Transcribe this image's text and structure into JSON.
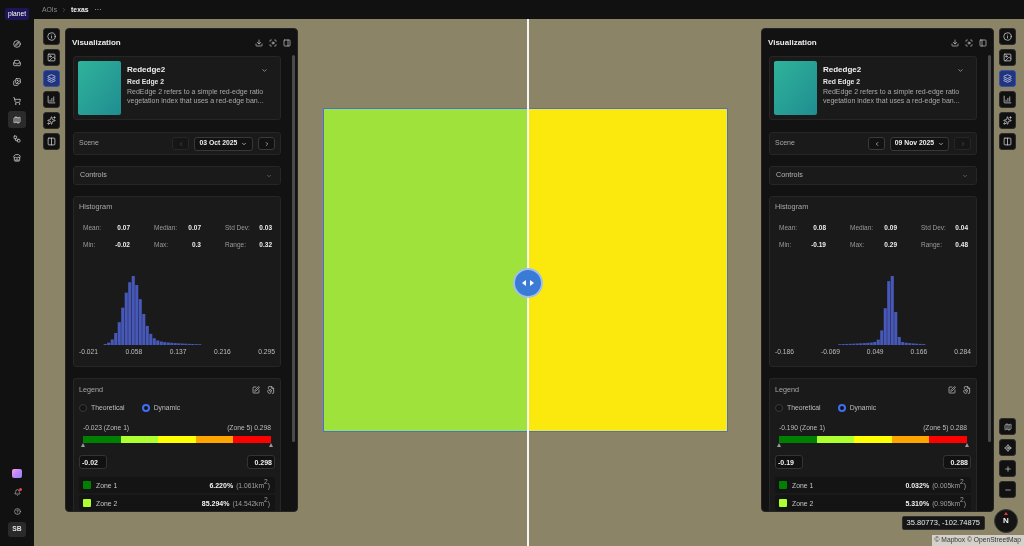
{
  "nav_rail": {
    "logo_text": "planet",
    "items": [
      {
        "selected": false
      },
      {
        "selected": false
      },
      {
        "selected": false
      },
      {
        "selected": false
      },
      {
        "selected": true
      },
      {
        "selected": false
      },
      {
        "selected": false
      }
    ],
    "has_notification": true,
    "avatar": "SB"
  },
  "breadcrumb": {
    "items": [
      "AOIs",
      "texas"
    ],
    "more": "···"
  },
  "panels": [
    {
      "tools": [
        {
          "selected": false
        },
        {
          "selected": false
        },
        {
          "selected": true
        },
        {
          "selected": false
        },
        {
          "selected": false
        },
        {
          "selected": false
        }
      ],
      "title": "Visualization",
      "layer": {
        "name": "Rededge2",
        "subtitle": "Red Edge 2",
        "description": "RedEdge 2 refers to a simple red-edge ratio vegetation index that uses a red-edge ban...",
        "expanded": false
      },
      "scene": {
        "label": "Scene",
        "date": "03 Oct 2025",
        "prev_disabled": true,
        "next_disabled": false
      },
      "controls": {
        "label": "Controls",
        "expanded": false
      },
      "histogram": {
        "title": "Histogram",
        "stats": [
          {
            "label": "Mean:",
            "value": "0.07"
          },
          {
            "label": "Median:",
            "value": "0.07"
          },
          {
            "label": "Std Dev:",
            "value": "0.03"
          },
          {
            "label": "Min:",
            "value": "-0.02"
          },
          {
            "label": "Max:",
            "value": "0.3"
          },
          {
            "label": "Range:",
            "value": "0.32"
          }
        ],
        "axis_labels": [
          "-0.021",
          "0.058",
          "0.137",
          "0.216",
          "0.295"
        ]
      },
      "legend": {
        "title": "Legend",
        "modes": [
          {
            "label": "Theoretical",
            "selected": false
          },
          {
            "label": "Dynamic",
            "selected": true
          }
        ],
        "min_label": "-0.023 (Zone 1)",
        "max_label": "(Zone 5) 0.298",
        "segments": [
          {
            "color": "#008000"
          },
          {
            "color": "#adff2f"
          },
          {
            "color": "#ffff00"
          },
          {
            "color": "#ffa500"
          },
          {
            "color": "#ff0000"
          }
        ],
        "min_value": "-0.02",
        "max_value": "0.298",
        "zones": [
          {
            "name": "Zone 1",
            "color": "#008000",
            "percent": "6.220%",
            "area": "(1.061km$^{2}$)"
          },
          {
            "name": "Zone 2",
            "color": "#adff2f",
            "percent": "85.294%",
            "area": "(14.542km$^{2}$)"
          }
        ]
      }
    },
    {
      "tools": [
        {
          "selected": false
        },
        {
          "selected": false
        },
        {
          "selected": true
        },
        {
          "selected": false
        },
        {
          "selected": false
        },
        {
          "selected": false
        }
      ],
      "title": "Visualization",
      "layer": {
        "name": "Rededge2",
        "subtitle": "Red Edge 2",
        "description": "RedEdge 2 refers to a simple red-edge ratio vegetation index that uses a red-edge ban...",
        "expanded": false
      },
      "scene": {
        "label": "Scene",
        "date": "09 Nov 2025",
        "prev_disabled": false,
        "next_disabled": true
      },
      "controls": {
        "label": "Controls",
        "expanded": false
      },
      "histogram": {
        "title": "Histogram",
        "stats": [
          {
            "label": "Mean:",
            "value": "0.08"
          },
          {
            "label": "Median:",
            "value": "0.09"
          },
          {
            "label": "Std Dev:",
            "value": "0.04"
          },
          {
            "label": "Min:",
            "value": "-0.19"
          },
          {
            "label": "Max:",
            "value": "0.29"
          },
          {
            "label": "Range:",
            "value": "0.48"
          }
        ],
        "axis_labels": [
          "-0.186",
          "-0.069",
          "0.049",
          "0.166",
          "0.284"
        ]
      },
      "legend": {
        "title": "Legend",
        "modes": [
          {
            "label": "Theoretical",
            "selected": false
          },
          {
            "label": "Dynamic",
            "selected": true
          }
        ],
        "min_label": "-0.190 (Zone 1)",
        "max_label": "(Zone 5) 0.288",
        "segments": [
          {
            "color": "#008000"
          },
          {
            "color": "#adff2f"
          },
          {
            "color": "#ffff00"
          },
          {
            "color": "#ffa500"
          },
          {
            "color": "#ff0000"
          }
        ],
        "min_value": "-0.19",
        "max_value": "0.288",
        "zones": [
          {
            "name": "Zone 1",
            "color": "#008000",
            "percent": "0.032%",
            "area": "(0.005km$^{2}$)"
          },
          {
            "name": "Zone 2",
            "color": "#adff2f",
            "percent": "5.310%",
            "area": "(0.905km$^{2}$)"
          }
        ]
      }
    }
  ],
  "map": {
    "coordinates": "35.80773, -102.74875",
    "compass_label": "N",
    "attribution": "© Mapbox © OpenStreetMap"
  }
}
